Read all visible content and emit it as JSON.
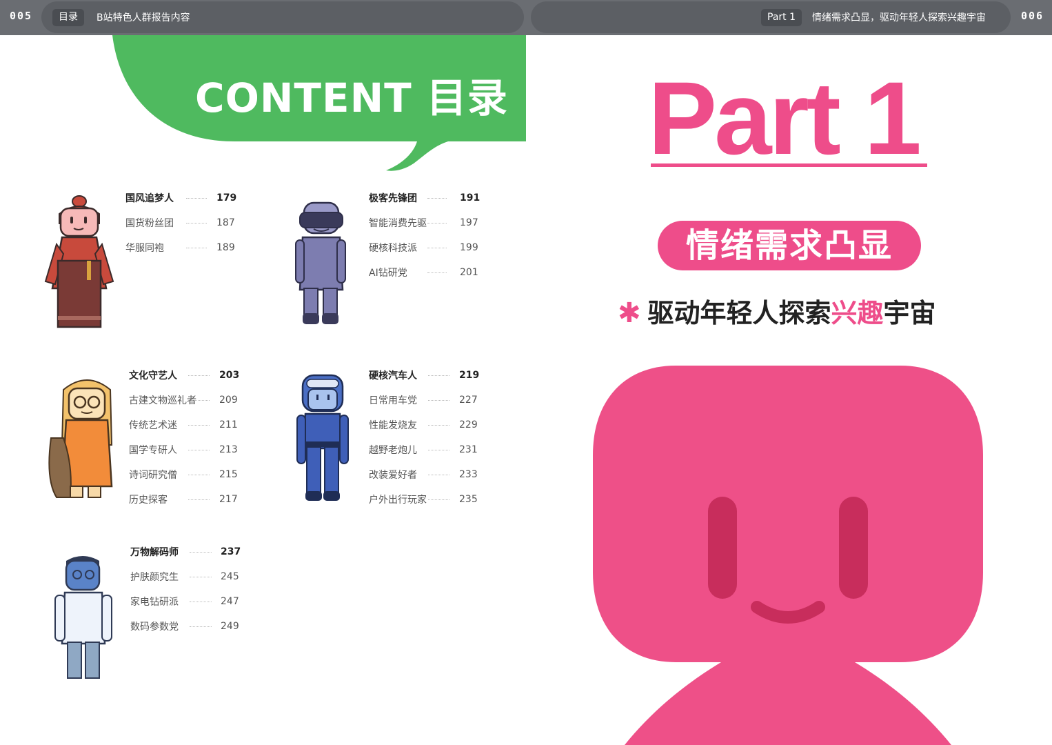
{
  "topbar": {
    "left_page": "005",
    "right_page": "006",
    "left_tag": "目录",
    "left_title": "B站特色人群报告内容",
    "right_tag": "Part 1",
    "right_title": "情绪需求凸显，驱动年轻人探索兴趣宇宙"
  },
  "content_header": {
    "title": "CONTENT 目录",
    "bubble_color": "#4fba5f"
  },
  "toc": [
    {
      "character": "hanfu-girl-icon",
      "items": [
        {
          "label": "国风追梦人",
          "page": "179",
          "bold": true
        },
        {
          "label": "国货粉丝团",
          "page": "187"
        },
        {
          "label": "华服同袍",
          "page": "189"
        }
      ]
    },
    {
      "character": "vr-geek-icon",
      "items": [
        {
          "label": "极客先锋团",
          "page": "191",
          "bold": true
        },
        {
          "label": "智能消费先驱",
          "page": "197"
        },
        {
          "label": "硬核科技派",
          "page": "199"
        },
        {
          "label": "AI钻研党",
          "page": "201"
        }
      ]
    },
    {
      "character": "scholar-girl-icon",
      "items": [
        {
          "label": "文化守艺人",
          "page": "203",
          "bold": true
        },
        {
          "label": "古建文物巡礼者",
          "page": "209"
        },
        {
          "label": "传统艺术迷",
          "page": "211"
        },
        {
          "label": "国学专研人",
          "page": "213"
        },
        {
          "label": "诗词研究僧",
          "page": "215"
        },
        {
          "label": "历史探客",
          "page": "217"
        }
      ]
    },
    {
      "character": "racer-icon",
      "items": [
        {
          "label": "硬核汽车人",
          "page": "219",
          "bold": true
        },
        {
          "label": "日常用车党",
          "page": "227"
        },
        {
          "label": "性能发烧友",
          "page": "229"
        },
        {
          "label": "越野老炮儿",
          "page": "231"
        },
        {
          "label": "改装爱好者",
          "page": "233"
        },
        {
          "label": "户外出行玩家",
          "page": "235"
        }
      ]
    },
    {
      "character": "lab-scientist-icon",
      "items": [
        {
          "label": "万物解码师",
          "page": "237",
          "bold": true
        },
        {
          "label": "护肤颜究生",
          "page": "245"
        },
        {
          "label": "家电钻研派",
          "page": "247"
        },
        {
          "label": "数码参数党",
          "page": "249"
        }
      ]
    }
  ],
  "part": {
    "title": "Part 1",
    "pill_text": "情绪需求凸显",
    "subtitle_star": "✱",
    "subtitle_before": "驱动年轻人探索",
    "subtitle_highlight": "兴趣",
    "subtitle_after": "宇宙",
    "accent_color": "#ee4d8a"
  }
}
